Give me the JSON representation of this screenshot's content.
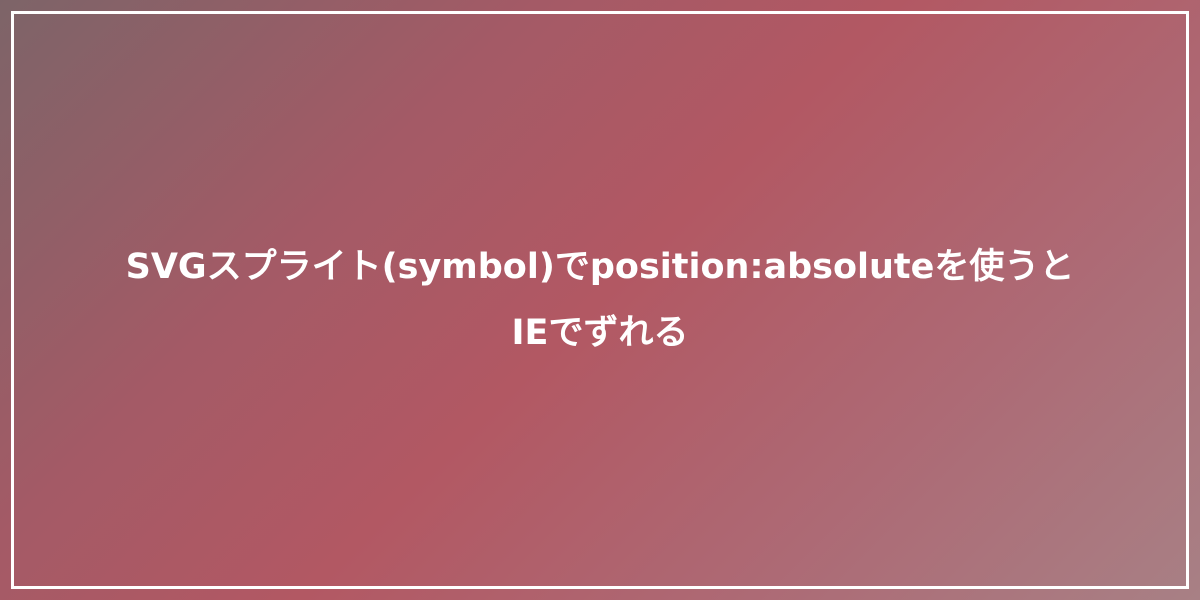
{
  "card": {
    "title_line1": "SVGスプライト(symbol)でposition:absoluteを使うと",
    "title_line2": "IEでずれる"
  }
}
